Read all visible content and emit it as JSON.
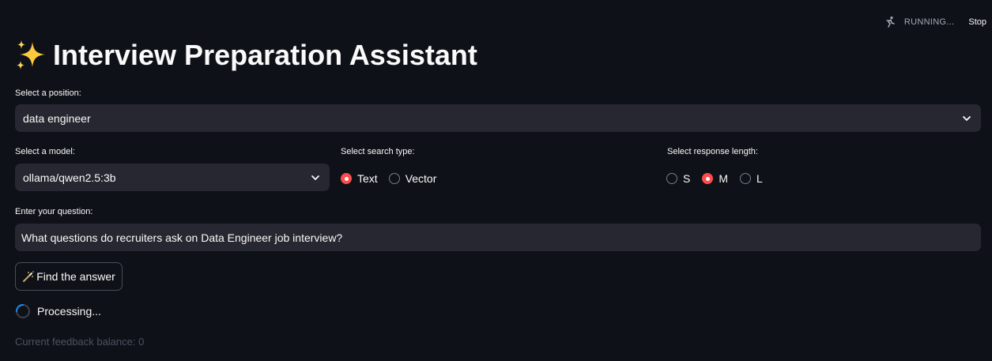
{
  "status": {
    "running_text": "RUNNING...",
    "stop_label": "Stop",
    "icon": "running-man-icon"
  },
  "title": {
    "text": "Interview Preparation Assistant",
    "icon": "sparkles-icon"
  },
  "position": {
    "label": "Select a position:",
    "value": "data engineer"
  },
  "model": {
    "label": "Select a model:",
    "value": "ollama/qwen2.5:3b"
  },
  "search_type": {
    "label": "Select search type:",
    "options": [
      "Text",
      "Vector"
    ],
    "selected": "Text"
  },
  "response_length": {
    "label": "Select response length:",
    "options": [
      "S",
      "M",
      "L"
    ],
    "selected": "M"
  },
  "question": {
    "label": "Enter your question:",
    "value": "What questions do recruiters ask on Data Engineer job interview?"
  },
  "find_button": {
    "label": "Find the answer",
    "icon": "magic-wand-icon"
  },
  "processing": {
    "text": "Processing..."
  },
  "feedback": {
    "text": "Current feedback balance: 0"
  },
  "colors": {
    "background": "#0e1117",
    "input_bg": "#262730",
    "accent": "#ff4b4b",
    "spinner": "#1c83e1"
  }
}
